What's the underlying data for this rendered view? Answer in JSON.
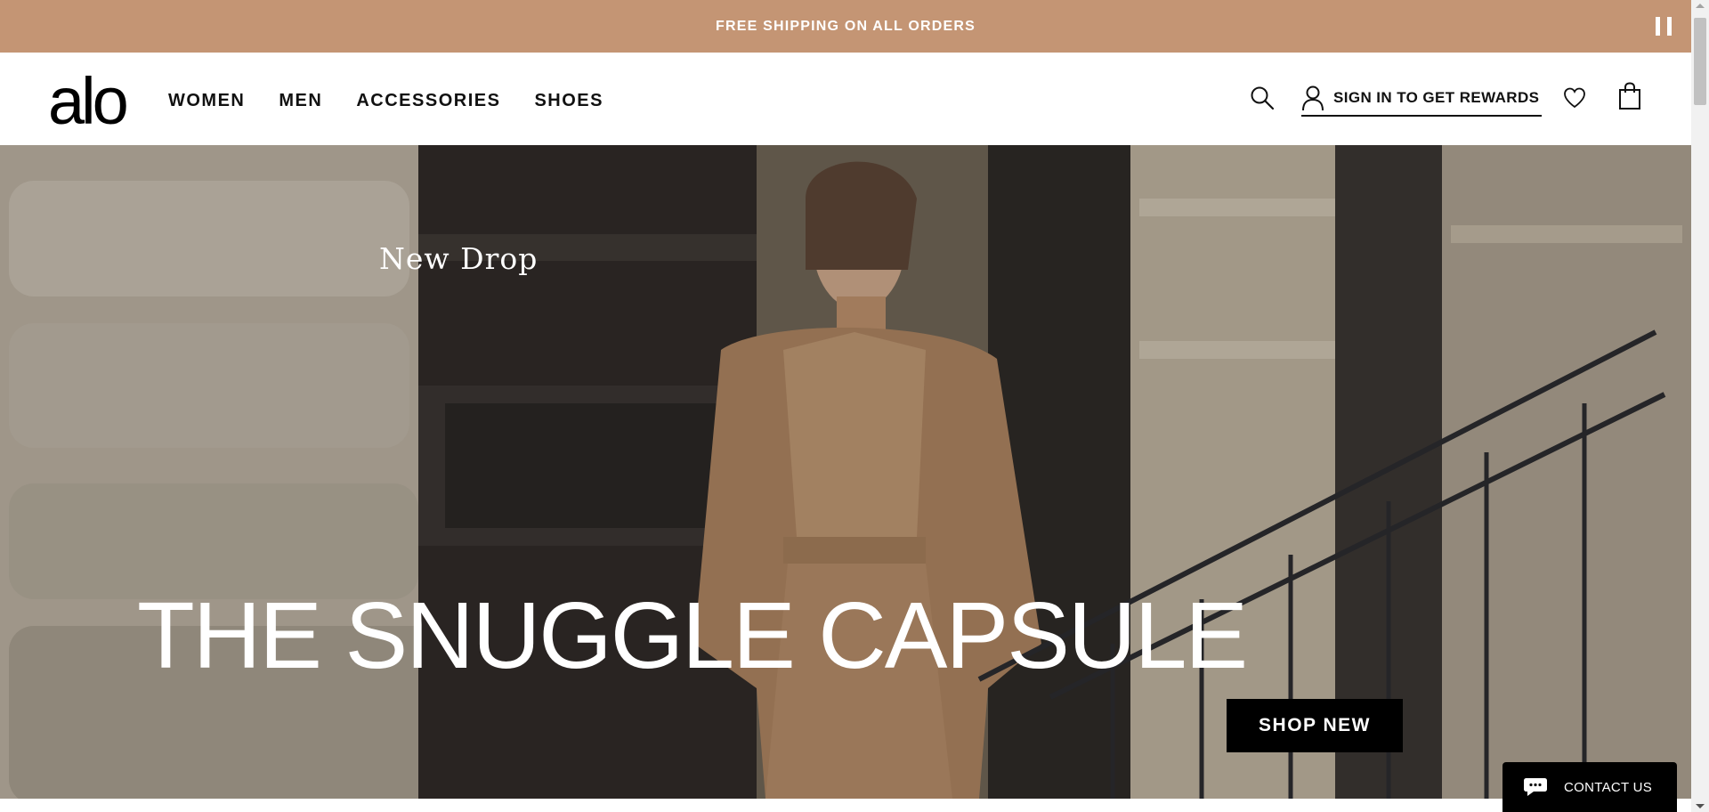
{
  "announcement": {
    "text": "FREE SHIPPING ON ALL ORDERS"
  },
  "header": {
    "logo": "alo",
    "nav": [
      "WOMEN",
      "MEN",
      "ACCESSORIES",
      "SHOES"
    ],
    "signin_label": "SIGN IN TO GET REWARDS",
    "icons": [
      "search-icon",
      "user-icon",
      "heart-icon",
      "bag-icon"
    ]
  },
  "hero": {
    "eyebrow": "New Drop",
    "title": "THE SNUGGLE CAPSULE",
    "cta_label": "SHOP NEW"
  },
  "contact": {
    "label": "CONTACT US"
  },
  "colors": {
    "announcement_bg": "#c49574",
    "accent_black": "#000000",
    "white": "#ffffff"
  }
}
